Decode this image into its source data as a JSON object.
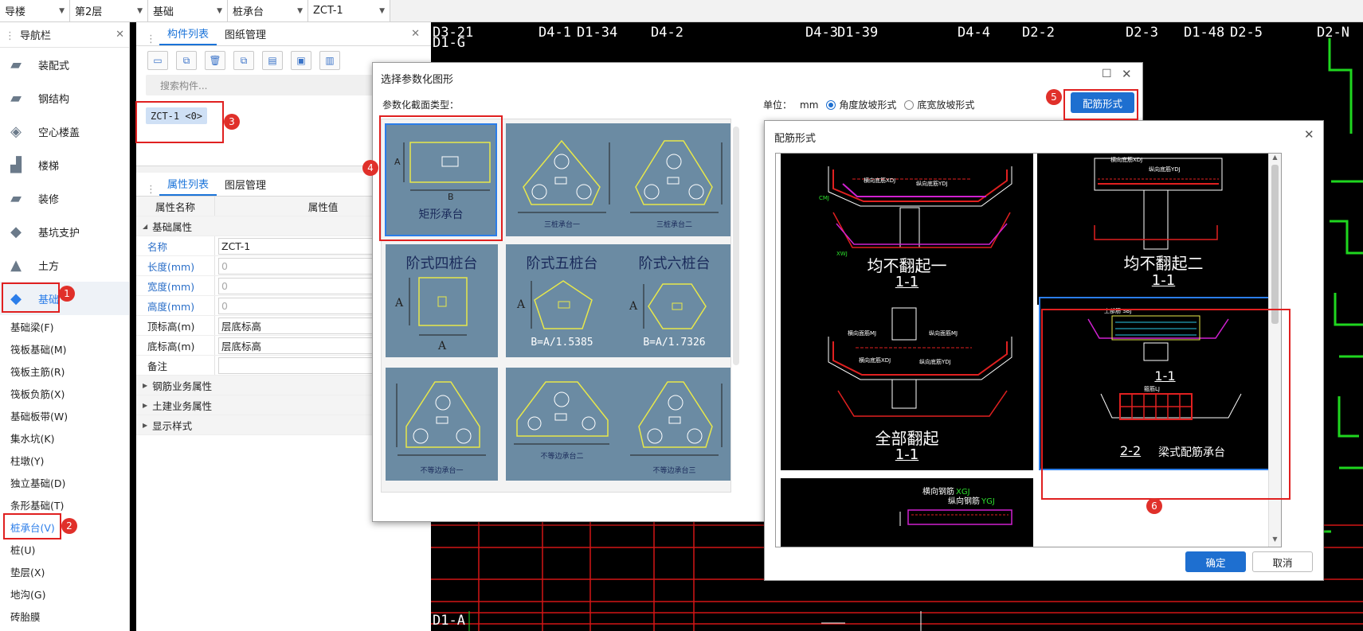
{
  "topbar": {
    "floor_type": "导楼",
    "floor": "第2层",
    "category": "基础",
    "subtype": "桩承台",
    "component": "ZCT-1"
  },
  "nav": {
    "title": "导航栏",
    "categories": [
      {
        "label": "装配式"
      },
      {
        "label": "钢结构"
      },
      {
        "label": "空心楼盖"
      },
      {
        "label": "楼梯"
      },
      {
        "label": "装修"
      },
      {
        "label": "基坑支护"
      },
      {
        "label": "土方"
      },
      {
        "label": "基础"
      }
    ],
    "sub_items": [
      "基础梁(F)",
      "筏板基础(M)",
      "筏板主筋(R)",
      "筏板负筋(X)",
      "基础板带(W)",
      "集水坑(K)",
      "柱墩(Y)",
      "独立基础(D)",
      "条形基础(T)",
      "桩承台(V)",
      "桩(U)",
      "垫层(X)",
      "地沟(G)",
      "砖胎膜"
    ]
  },
  "component_panel": {
    "tabs": [
      "构件列表",
      "图纸管理"
    ],
    "search_placeholder": "搜索构件...",
    "item": "ZCT-1 <0>"
  },
  "property_panel": {
    "tabs": [
      "属性列表",
      "图层管理"
    ],
    "col_name": "属性名称",
    "col_value": "属性值",
    "group_basic": "基础属性",
    "rows": [
      {
        "k": "名称",
        "v": "ZCT-1"
      },
      {
        "k": "长度(mm)",
        "v": "0"
      },
      {
        "k": "宽度(mm)",
        "v": "0"
      },
      {
        "k": "高度(mm)",
        "v": "0"
      },
      {
        "k": "顶标高(m)",
        "v": "层底标高"
      },
      {
        "k": "底标高(m)",
        "v": "层底标高"
      },
      {
        "k": "备注",
        "v": ""
      }
    ],
    "groups": [
      "钢筋业务属性",
      "土建业务属性",
      "显示样式"
    ]
  },
  "cad_labels": [
    "D3-21",
    "D4-1",
    "D1-34",
    "D4-2",
    "D4-3",
    "D1-39",
    "D4-4",
    "D2-2",
    "D2-3",
    "D1-48",
    "D2-5",
    "D2-N",
    "D1-G",
    "D1-A"
  ],
  "dialog1": {
    "title": "选择参数化图形",
    "section_label": "参数化截面类型：",
    "unit_label": "单位：",
    "unit_value": "mm",
    "radio1": "角度放坡形式",
    "radio2": "底宽放坡形式",
    "button": "配筋形式",
    "tiles": [
      {
        "label": "矩形承台"
      },
      {
        "label": "三桩承台一"
      },
      {
        "label": "三桩承台二"
      },
      {
        "label": "阶式四桩台"
      },
      {
        "label": "阶式五桩台",
        "formula": "B=A/1.5385"
      },
      {
        "label": "阶式六桩台",
        "formula": "B=A/1.7326"
      },
      {
        "label": "不等边承台一"
      },
      {
        "label": "不等边承台二"
      },
      {
        "label": "不等边承台三"
      }
    ]
  },
  "dialog2": {
    "title": "配筋形式",
    "tiles": [
      {
        "title": "均不翻起一",
        "section": "1-1"
      },
      {
        "title": "均不翻起二",
        "section": "1-1"
      },
      {
        "title": "全部翻起",
        "section": "1-1"
      },
      {
        "title": "梁式配筋承台",
        "section": "1-1",
        "section2": "2-2"
      },
      {
        "label1": "横向钢筋",
        "abbr1": "XGJ",
        "label2": "纵向钢筋",
        "abbr2": "YGJ"
      }
    ],
    "ok": "确定",
    "cancel": "取消"
  },
  "badges": [
    "1",
    "2",
    "3",
    "4",
    "5",
    "6"
  ]
}
